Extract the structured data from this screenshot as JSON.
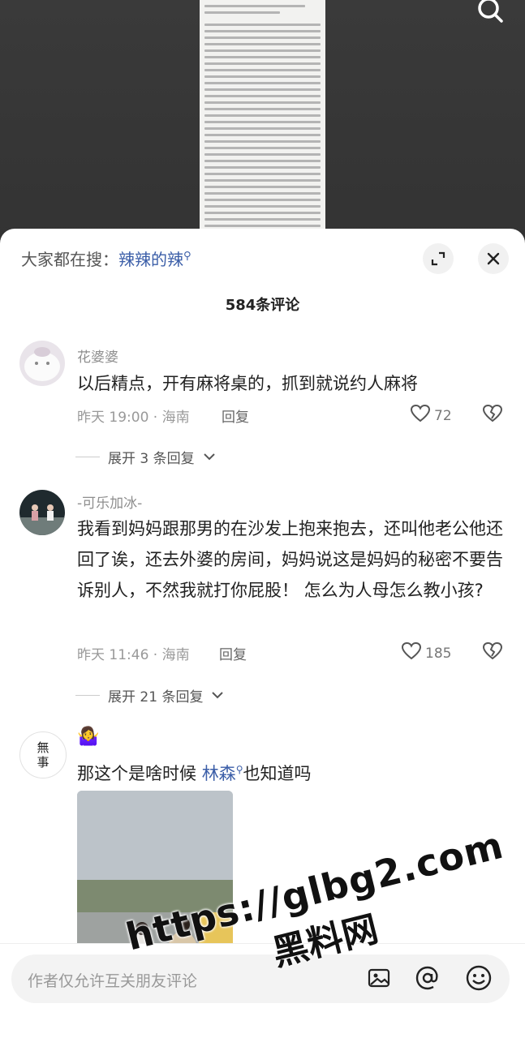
{
  "header": {
    "hot_search_prefix": "大家都在搜：",
    "hot_search_term": "辣辣的辣",
    "search_glyph": "ᵠ"
  },
  "comments_title": "584条评论",
  "comments": [
    {
      "username": "花婆婆",
      "text": "以后精点，开有麻将桌的，抓到就说约人麻将",
      "time_location": "昨天 19:00 · 海南",
      "reply_label": "回复",
      "likes": "72",
      "expand_label": "展开 3 条回复"
    },
    {
      "username": "-可乐加冰-",
      "text": "我看到妈妈跟那男的在沙发上抱来抱去，还叫他老公他还回了诶，还去外婆的房间，妈妈说这是妈妈的秘密不要告诉别人，不然我就打你屁股！ 怎么为人母怎么教小孩?",
      "time_location": "昨天 11:46 · 海南",
      "reply_label": "回复",
      "likes": "185",
      "expand_label": "展开 21 条回复"
    },
    {
      "username": "🤷‍♀️",
      "text_before": "那这个是啥时候 ",
      "text_link": "林森",
      "text_after": "也知道吗",
      "avatar_text": "無事"
    }
  ],
  "input": {
    "placeholder": "作者仅允许互关朋友评论"
  },
  "watermark": {
    "url": "https://glbg2.com",
    "name": "黑料网"
  },
  "icons": {
    "top": [
      "search-icon"
    ],
    "sheet": [
      "expand-icon",
      "close-icon"
    ],
    "bottom": [
      "image-icon",
      "at-icon",
      "emoji-icon"
    ]
  }
}
